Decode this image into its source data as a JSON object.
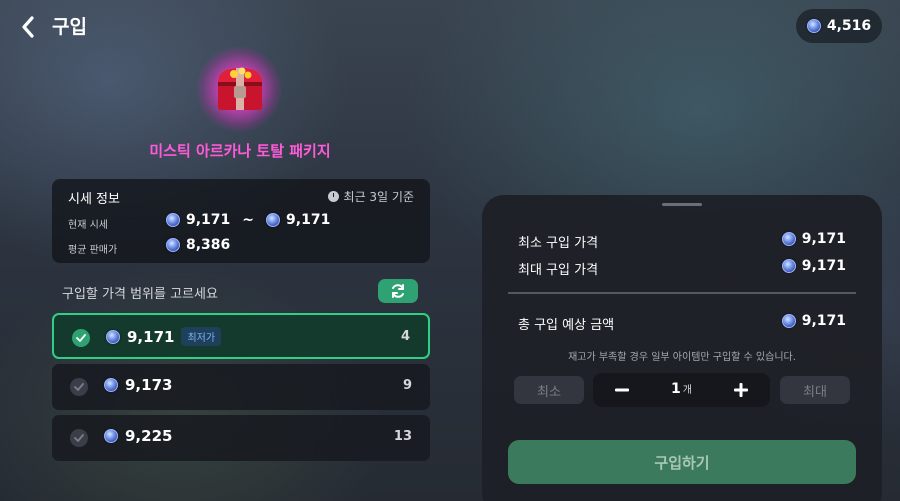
{
  "header": {
    "title": "구입",
    "balance": "4,516"
  },
  "item": {
    "name": "미스틱 아르카나 토탈 패키지"
  },
  "price_info": {
    "title": "시세 정보",
    "basis": "최근 3일 기준",
    "current_label": "현재 시세",
    "current_min": "9,171",
    "range_sep": "~",
    "current_max": "9,171",
    "average_label": "평균 판매가",
    "average": "8,386"
  },
  "range": {
    "label": "구입할 가격 범위를 고르세요",
    "options": [
      {
        "price": "9,171",
        "badge": "최저가",
        "qty": "4",
        "selected": true
      },
      {
        "price": "9,173",
        "qty": "9",
        "selected": false
      },
      {
        "price": "9,225",
        "qty": "13",
        "selected": false
      }
    ]
  },
  "summary": {
    "min_label": "최소 구입 가격",
    "min_value": "9,171",
    "max_label": "최대 구입 가격",
    "max_value": "9,171",
    "total_label": "총 구입 예상 금액",
    "total_value": "9,171",
    "notice": "재고가 부족할 경우 일부 아이템만 구입할 수 있습니다.",
    "min_btn": "최소",
    "max_btn": "최대",
    "quantity": "1",
    "quantity_unit": "개",
    "buy_btn": "구입하기"
  },
  "colors": {
    "accent_green": "#2fa273",
    "selected_border": "#2fcf86",
    "item_name": "#ff5ad8"
  }
}
